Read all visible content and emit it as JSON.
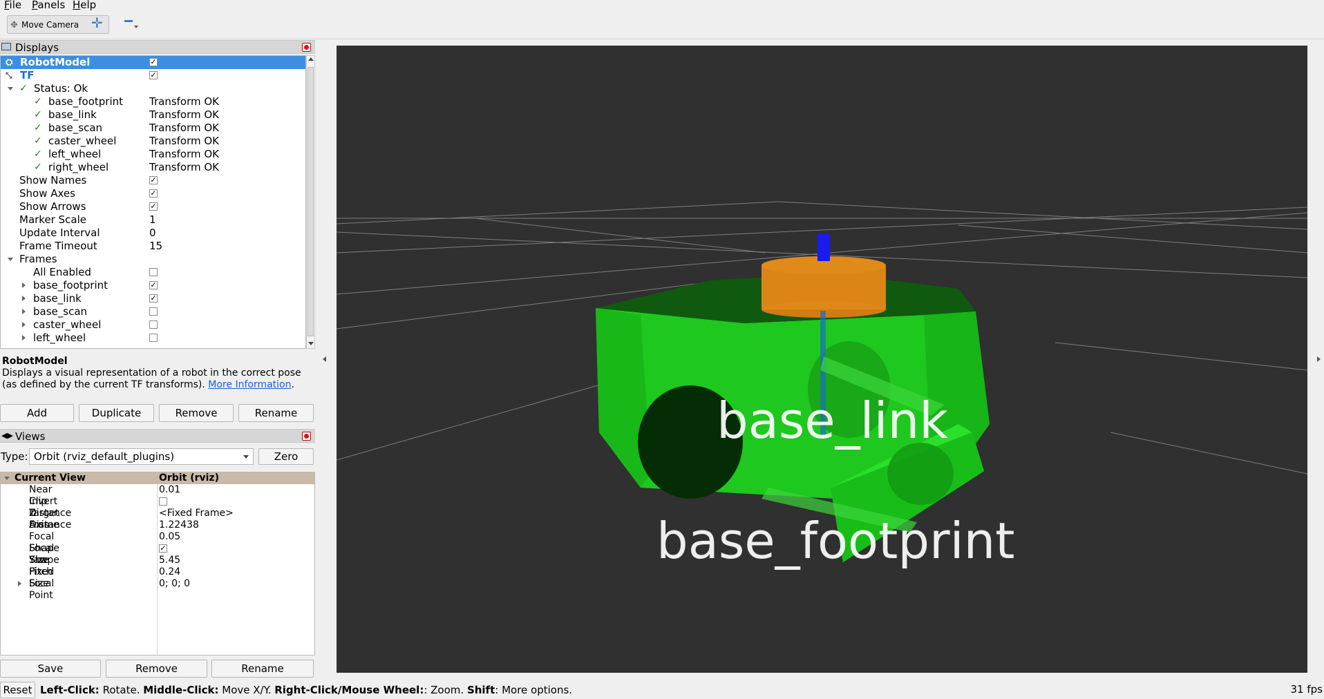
{
  "menu": {
    "file": "File",
    "panels": "Panels",
    "help": "Help"
  },
  "toolbar": {
    "move_camera": "Move Camera"
  },
  "displays_panel": {
    "title": "Displays",
    "rows": [
      {
        "name": "RobotModel",
        "value": "",
        "checked": true
      },
      {
        "name": "TF",
        "value": "",
        "checked": true
      },
      {
        "name": "Status: Ok",
        "value": ""
      },
      {
        "name": "base_footprint",
        "value": "Transform OK"
      },
      {
        "name": "base_link",
        "value": "Transform OK"
      },
      {
        "name": "base_scan",
        "value": "Transform OK"
      },
      {
        "name": "caster_wheel",
        "value": "Transform OK"
      },
      {
        "name": "left_wheel",
        "value": "Transform OK"
      },
      {
        "name": "right_wheel",
        "value": "Transform OK"
      },
      {
        "name": "Show Names",
        "checked": true
      },
      {
        "name": "Show Axes",
        "checked": true
      },
      {
        "name": "Show Arrows",
        "checked": true
      },
      {
        "name": "Marker Scale",
        "value": "1"
      },
      {
        "name": "Update Interval",
        "value": "0"
      },
      {
        "name": "Frame Timeout",
        "value": "15"
      },
      {
        "name": "Frames",
        "value": ""
      },
      {
        "name": "All Enabled",
        "checked": false
      },
      {
        "name": "base_footprint",
        "checked": true
      },
      {
        "name": "base_link",
        "checked": true
      },
      {
        "name": "base_scan",
        "checked": false
      },
      {
        "name": "caster_wheel",
        "checked": false
      },
      {
        "name": "left_wheel",
        "checked": false
      }
    ],
    "description_title": "RobotModel",
    "description_text": "Displays a visual representation of a robot in the correct pose (as defined by the current TF transforms).",
    "description_link": "More Information",
    "buttons": {
      "add": "Add",
      "duplicate": "Duplicate",
      "remove": "Remove",
      "rename": "Rename"
    }
  },
  "views_panel": {
    "title": "Views",
    "type_label": "Type:",
    "type_value": "Orbit (rviz_default_plugins)",
    "zero": "Zero",
    "header": {
      "name": "Current View",
      "value": "Orbit (rviz)"
    },
    "rows": [
      {
        "name": "Near Clip Distance",
        "value": "0.01"
      },
      {
        "name": "Invert Z Axis",
        "value": "",
        "checked": false
      },
      {
        "name": "Target Frame",
        "value": "<Fixed Frame>"
      },
      {
        "name": "Distance",
        "value": "1.22438"
      },
      {
        "name": "Focal Shape Size",
        "value": "0.05"
      },
      {
        "name": "Focal Shape Fixed Size",
        "value": "",
        "checked": true
      },
      {
        "name": "Yaw",
        "value": "5.45"
      },
      {
        "name": "Pitch",
        "value": "0.24"
      },
      {
        "name": "Focal Point",
        "value": "0; 0; 0"
      }
    ],
    "buttons": {
      "save": "Save",
      "remove": "Remove",
      "rename": "Rename"
    }
  },
  "viewport": {
    "labels": {
      "base_link": "base_link",
      "base_footprint": "base_footprint"
    },
    "colors": {
      "background": "#303030",
      "body": "#1fd51f",
      "lidar": "#e08a1a",
      "z_axis": "#1a1aee"
    }
  },
  "status": {
    "reset": "Reset",
    "hint_left_key": "Left-Click:",
    "hint_left": " Rotate. ",
    "hint_mid_key": "Middle-Click:",
    "hint_mid": " Move X/Y. ",
    "hint_right_key": "Right-Click/Mouse Wheel:",
    "hint_right": ": Zoom. ",
    "hint_shift_key": "Shift",
    "hint_shift": ": More options.",
    "fps": "31 fps"
  }
}
